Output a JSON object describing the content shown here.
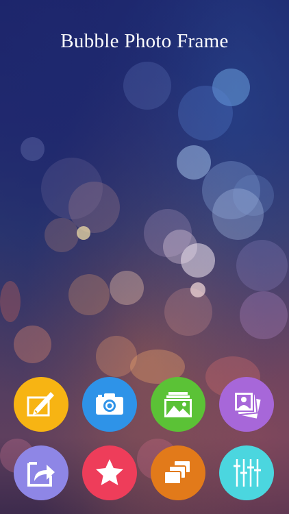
{
  "app": {
    "title": "Bubble Photo Frame"
  },
  "buttons": [
    {
      "name": "edit-button",
      "icon": "pen-paper-icon",
      "color": "#F7B413"
    },
    {
      "name": "camera-button",
      "icon": "camera-icon",
      "color": "#2E93E8"
    },
    {
      "name": "gallery-button",
      "icon": "image-gallery-icon",
      "color": "#5BC236"
    },
    {
      "name": "photo-album-button",
      "icon": "photos-stack-icon",
      "color": "#A767D9"
    },
    {
      "name": "share-button",
      "icon": "share-arrow-icon",
      "color": "#8E86E6"
    },
    {
      "name": "rate-button",
      "icon": "star-icon",
      "color": "#EE3D5A"
    },
    {
      "name": "more-apps-button",
      "icon": "stacked-cards-icon",
      "color": "#E27A1A"
    },
    {
      "name": "settings-button",
      "icon": "sliders-icon",
      "color": "#4BD6DF"
    }
  ]
}
